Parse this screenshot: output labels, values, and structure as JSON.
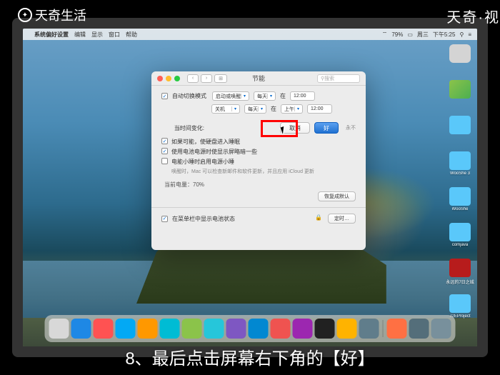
{
  "watermark": {
    "top_left": "天奇生活",
    "top_right": "天奇·视"
  },
  "menubar": {
    "app": "系统偏好设置",
    "items": [
      "编辑",
      "显示",
      "窗口",
      "帮助"
    ],
    "right": {
      "wifi": "􀙇",
      "battery_pct": "79%",
      "day": "周三",
      "time": "下午5:25"
    }
  },
  "desktop": {
    "icons": [
      "",
      "",
      "",
      "WooShe 3",
      "WooShe",
      "comjava",
      "永远的7日之城",
      "J2EProject"
    ]
  },
  "prefs": {
    "title": "节能",
    "search_placeholder": "搜索",
    "section1_label": "自动切换模式",
    "section1": {
      "startup_label": "启动或唤醒",
      "shutdown_label": "关机",
      "every1": "每天",
      "every2": "每天",
      "ampm": "上午",
      "time": "12:00"
    },
    "btn_cancel": "取消",
    "btn_ok": "好",
    "confirm_label": "当时间变化:",
    "opts": [
      "如果可能，使硬盘进入睡眠",
      "使用电池电源时使显示屏略暗一些",
      "电能小睡时启用电源小睡"
    ],
    "hint": "唤醒时，Mac 可以检查新邮件和软件更新，并且应用 iCloud 更新",
    "battery_status": "当前电量：70%",
    "btn_restore": "恢复成默认",
    "bottom_check": "在菜单栏中显示电池状态",
    "btn_schedule": "定时…"
  },
  "dock_colors": [
    "#d8d8d8",
    "#1e88e5",
    "#ff5252",
    "#03a9f4",
    "#ff9800",
    "#00bcd4",
    "#8bc34a",
    "#26c6da",
    "#7e57c2",
    "#0288d1",
    "#ef5350",
    "#9c27b0",
    "#212121",
    "#ffb300",
    "#607d8b",
    "#ff7043",
    "#546e7a",
    "#78909c"
  ],
  "subtitle": "8、最后点击屏幕右下角的【好】"
}
